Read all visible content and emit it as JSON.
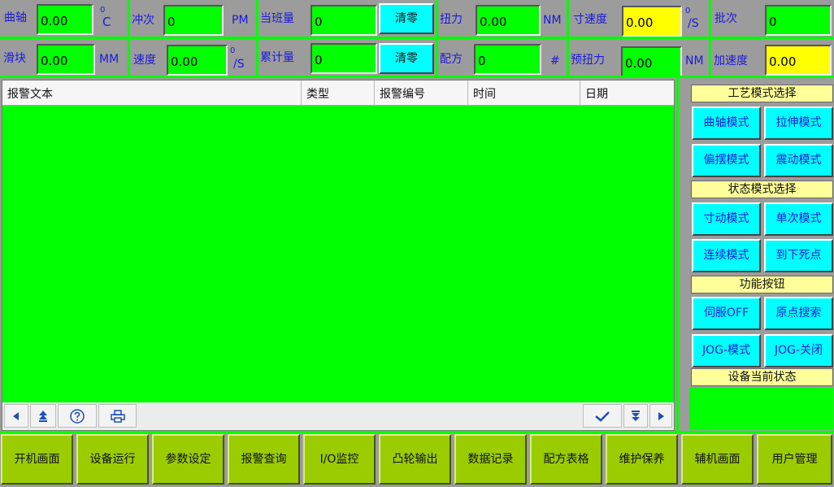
{
  "top_row1": {
    "crank_label": "曲轴",
    "crank_value": "0.00",
    "crank_unit_sup": "0",
    "crank_unit": "C",
    "stroke_label": "冲次",
    "stroke_value": "0",
    "stroke_unit": "PM",
    "shift_label": "当班量",
    "shift_value": "0",
    "shift_clear": "清零",
    "torque_label": "扭力",
    "torque_value": "0.00",
    "torque_unit": "NM",
    "inch_speed_label": "寸速度",
    "inch_speed_value": "0.00",
    "inch_speed_sup": "0",
    "inch_speed_unit": "/S",
    "batch_label": "批次",
    "batch_value": "0"
  },
  "top_row2": {
    "slider_label": "滑块",
    "slider_value": "0.00",
    "slider_unit": "MM",
    "speed_label": "速度",
    "speed_value": "0.00",
    "speed_sup": "0",
    "speed_unit": "/S",
    "total_label": "累计量",
    "total_value": "0",
    "total_clear": "清零",
    "recipe_label": "配方",
    "recipe_value": "0",
    "recipe_unit": "#",
    "pretorque_label": "预扭力",
    "pretorque_value": "0.00",
    "pretorque_unit": "NM",
    "accel_label": "加速度",
    "accel_value": "0.00"
  },
  "alarm": {
    "columns": [
      "报警文本",
      "类型",
      "报警编号",
      "时间",
      "日期"
    ]
  },
  "right_panel": {
    "process_title": "工艺模式选择",
    "process_buttons": [
      "曲轴模式",
      "拉伸模式",
      "偏摆模式",
      "震动模式"
    ],
    "state_title": "状态模式选择",
    "state_buttons": [
      "寸动模式",
      "单次模式",
      "连续模式",
      "到下死点"
    ],
    "func_title": "功能按钮",
    "func_buttons": [
      "伺服OFF",
      "原点搜索",
      "JOG-模式",
      "JOG-关闭"
    ],
    "status_title": "设备当前状态"
  },
  "nav": [
    "开机画面",
    "设备运行",
    "参数设定",
    "报警查询",
    "I/O监控",
    "凸轮输出",
    "数据记录",
    "配方表格",
    "维护保养",
    "辅机画面",
    "用户管理"
  ],
  "colors": {
    "panel_bg": "#9c9c9c",
    "green": "#00ff00",
    "yellow": "#ffff00",
    "cyan": "#00ffff",
    "label_blue": "#1a1adc",
    "nav_green": "#9acc00",
    "title_yellow": "#ffff99"
  },
  "icons": [
    "arrow-left-icon",
    "arrow-up-first-icon",
    "help-icon",
    "print-icon",
    "check-icon",
    "arrow-down-last-icon",
    "arrow-right-icon"
  ]
}
